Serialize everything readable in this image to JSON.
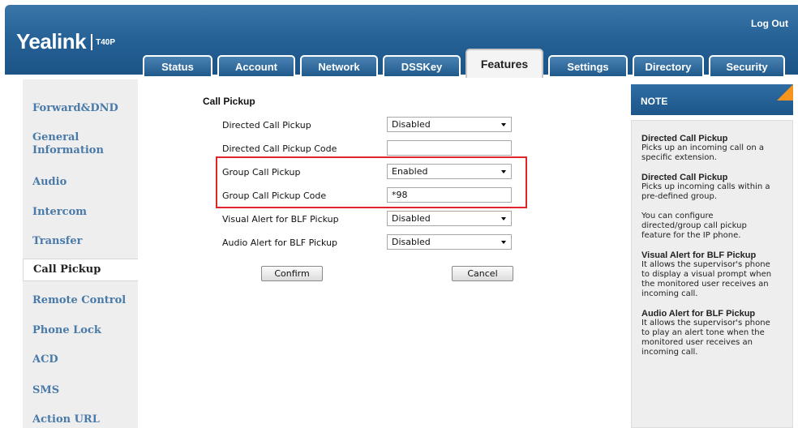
{
  "header": {
    "logo": "Yealink",
    "model": "T40P",
    "logout": "Log Out",
    "tabs": [
      {
        "label": "Status"
      },
      {
        "label": "Account"
      },
      {
        "label": "Network"
      },
      {
        "label": "DSSKey"
      },
      {
        "label": "Features",
        "active": true
      },
      {
        "label": "Settings"
      },
      {
        "label": "Directory"
      },
      {
        "label": "Security"
      }
    ]
  },
  "sidebar": {
    "items": [
      {
        "label": "Forward&DND"
      },
      {
        "label": "General"
      },
      {
        "label": "Information"
      },
      {
        "label": "Audio"
      },
      {
        "label": "Intercom"
      },
      {
        "label": "Transfer"
      },
      {
        "label": "Call Pickup",
        "active": true
      },
      {
        "label": "Remote Control"
      },
      {
        "label": "Phone Lock"
      },
      {
        "label": "ACD"
      },
      {
        "label": "SMS"
      },
      {
        "label": "Action URL"
      }
    ]
  },
  "main": {
    "section_title": "Call Pickup",
    "rows": [
      {
        "label": "Directed Call Pickup",
        "value": "Disabled",
        "type": "select"
      },
      {
        "label": "Directed Call Pickup Code",
        "value": "",
        "type": "text"
      },
      {
        "label": "Group Call Pickup",
        "value": "Enabled",
        "type": "select"
      },
      {
        "label": "Group Call Pickup Code",
        "value": "*98",
        "type": "text"
      },
      {
        "label": "Visual Alert for BLF Pickup",
        "value": "Disabled",
        "type": "select"
      },
      {
        "label": "Audio Alert for BLF Pickup",
        "value": "Disabled",
        "type": "select"
      }
    ],
    "confirm": "Confirm",
    "cancel": "Cancel"
  },
  "note": {
    "header": "NOTE",
    "blocks": [
      {
        "title": "Directed Call Pickup",
        "lines": [
          "Picks up an incoming call on a",
          "specific extension."
        ]
      },
      {
        "title": "Directed Call Pickup",
        "lines": [
          "Picks up incoming calls within a",
          "pre-defined group."
        ]
      },
      {
        "title": "",
        "lines": [
          "You can configure",
          "directed/group call pickup",
          "feature for the IP phone."
        ]
      },
      {
        "title": "Visual Alert for BLF Pickup",
        "lines": [
          "It allows the supervisor's phone",
          "to display a visual prompt when",
          "the monitored user receives an",
          "incoming call."
        ]
      },
      {
        "title": "Audio Alert for BLF Pickup",
        "lines": [
          "It allows the supervisor's phone",
          "to play an alert tone when the",
          "monitored user receives an",
          "incoming call."
        ]
      }
    ]
  },
  "colors": {
    "header_blue": "#245f94",
    "sidebar_link": "#4a7aa8",
    "highlight_red": "#e0262b",
    "note_corner": "#f7941e"
  }
}
